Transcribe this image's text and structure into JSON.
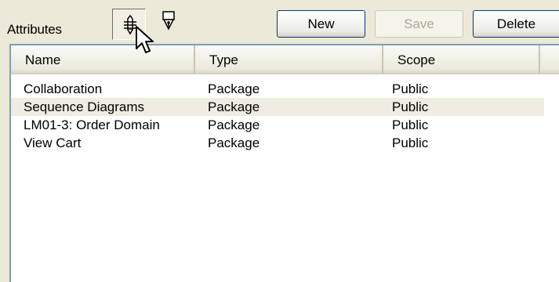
{
  "toolbar": {
    "title": "Attributes",
    "new_label": "New",
    "save_label": "Save",
    "delete_label": "Delete"
  },
  "list": {
    "columns": [
      "Name",
      "Type",
      "Scope"
    ],
    "rows": [
      {
        "name": "Collaboration",
        "type": "Package",
        "scope": "Public"
      },
      {
        "name": "Sequence Diagrams",
        "type": "Package",
        "scope": "Public"
      },
      {
        "name": "LM01-3: Order Domain",
        "type": "Package",
        "scope": "Public"
      },
      {
        "name": "View Cart",
        "type": "Package",
        "scope": "Public"
      }
    ],
    "selected_row": 1
  },
  "icons": {
    "toggle_1": "pencil-stack-icon",
    "toggle_2": "pen-nib-icon",
    "cursor": "mouse-pointer-icon"
  }
}
